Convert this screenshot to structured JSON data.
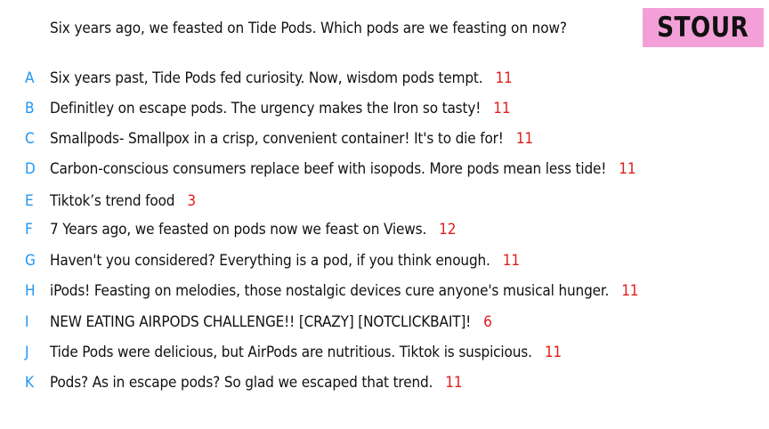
{
  "prompt": "Six years ago, we feasted on Tide Pods. Which pods are we feasting on now?",
  "badge": "STOUR",
  "colors": {
    "letter": "#2196f3",
    "score": "#e11b1b",
    "badge_bg": "#f4a0d8"
  },
  "answers": [
    {
      "letter": "A",
      "text": "Six years past, Tide Pods fed curiosity. Now, wisdom pods tempt.",
      "score": "11"
    },
    {
      "letter": "B",
      "text": "Definitley on escape pods. The urgency makes the Iron so tasty!",
      "score": "11"
    },
    {
      "letter": "C",
      "text": "Smallpods- Smallpox in a crisp, convenient container! It's to die for!",
      "score": "11"
    },
    {
      "letter": "D",
      "text": "Carbon-conscious consumers replace beef with isopods. More pods mean less tide!",
      "score": "11"
    },
    {
      "letter": "E",
      "text": "Tiktok’s trend food",
      "score": "3"
    },
    {
      "letter": "F",
      "text": "7 Years ago, we feasted on pods now we feast on Views.",
      "score": "12"
    },
    {
      "letter": "G",
      "text": "Haven't you considered? Everything is a pod, if you think enough.",
      "score": "11"
    },
    {
      "letter": "H",
      "text": "iPods! Feasting on melodies, those nostalgic devices cure anyone's musical hunger.",
      "score": "11"
    },
    {
      "letter": "I",
      "text": "NEW EATING AIRPODS CHALLENGE!! [CRAZY] [NOTCLICKBAIT]!",
      "score": "6"
    },
    {
      "letter": "J",
      "text": "Tide Pods were delicious, but AirPods are nutritious. Tiktok is suspicious.",
      "score": "11"
    },
    {
      "letter": "K",
      "text": "Pods? As in escape pods? So glad we escaped that trend.",
      "score": "11"
    }
  ]
}
